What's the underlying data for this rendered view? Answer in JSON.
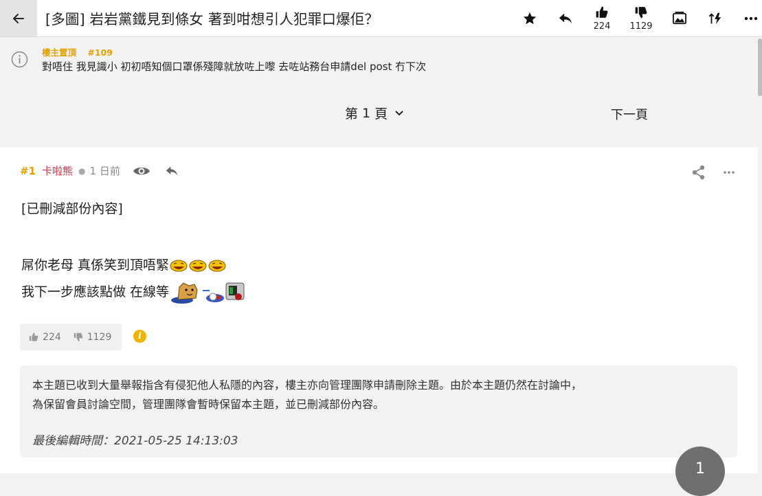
{
  "topbar": {
    "title": "[多圖] 岩岩黨鐵見到條女 著到咁想引人犯罪口爆佢？",
    "like_count": "224",
    "dislike_count": "1129"
  },
  "pinned": {
    "label": "樓主置頂",
    "floor": "#109",
    "text": "對唔住 我見識小 初初唔知個口罩係殘障就放咗上嚟 去咗站務台申請del post 冇下次"
  },
  "pager": {
    "prefix": "第",
    "page": "1",
    "suffix": "頁",
    "next": "下一頁"
  },
  "post": {
    "number": "#1",
    "username": "卡啦熊",
    "time": "1 日前",
    "lines": [
      "[已刪減部份內容]",
      "屌你老母 真係笑到頂唔緊",
      "我下一步應該點做 在線等"
    ],
    "likes": "224",
    "dislikes": "1129",
    "info_glyph": "i"
  },
  "notice": {
    "text_line1": "本主題已收到大量舉報指含有侵犯他人私隱的內容，樓主亦向管理團隊申請刪除主題。由於本主題仍然在討論中，",
    "text_line2": "為保留會員討論空間，管理團隊會暫時保留本主題，並已刪減部份內容。",
    "last_edit": "最後編輯時間：2021-05-25 14:13:03"
  },
  "fab": {
    "label": "1"
  },
  "colors": {
    "accent_yellow": "#e3a200",
    "username_red": "#d2354b",
    "info_badge": "#f0b400"
  },
  "icons": [
    "back-arrow-icon",
    "star-icon",
    "reply-icon",
    "thumbs-up-icon",
    "thumbs-down-icon",
    "image-icon",
    "sort-flash-icon",
    "more-icon",
    "info-icon",
    "chevron-down-icon",
    "eye-icon",
    "share-icon",
    "laugh-emoji-icon",
    "dog-emoji-icon"
  ]
}
